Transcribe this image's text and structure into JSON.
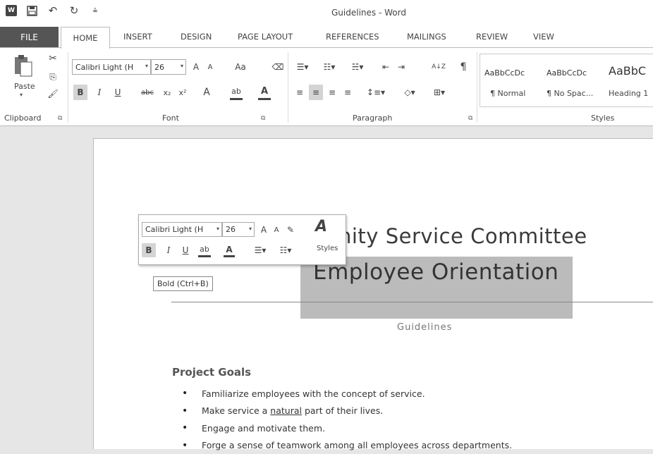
{
  "window": {
    "title": "Guidelines - Word",
    "qat": {
      "app_icon_label": "W",
      "save_icon": "save-icon",
      "undo_icon": "undo-icon",
      "redo_icon": "redo-icon",
      "customize_icon": "customize-qat-icon"
    }
  },
  "tabs": [
    "FILE",
    "HOME",
    "INSERT",
    "DESIGN",
    "PAGE LAYOUT",
    "REFERENCES",
    "MAILINGS",
    "REVIEW",
    "VIEW"
  ],
  "ribbon": {
    "clipboard": {
      "label": "Clipboard",
      "paste": "Paste"
    },
    "font": {
      "label": "Font",
      "font_name": "Calibri Light (H",
      "font_size": "26",
      "grow": "A",
      "shrink": "A",
      "case": "Aa",
      "bold": "B",
      "italic": "I",
      "underline": "U",
      "strike": "abc",
      "subscript": "x₂",
      "superscript": "x²",
      "effects": "A",
      "highlight": "ab",
      "color": "A"
    },
    "paragraph": {
      "label": "Paragraph",
      "sort": "A↓Z",
      "pilcrow": "¶"
    },
    "styles": {
      "label": "Styles",
      "items": [
        {
          "sample": "AaBbCcDc",
          "name": "¶ Normal"
        },
        {
          "sample": "AaBbCcDc",
          "name": "¶ No Spac..."
        },
        {
          "sample": "AaBbC",
          "name": "Heading 1"
        }
      ]
    }
  },
  "mini_toolbar": {
    "font_name": "Calibri Light (H",
    "font_size": "26",
    "grow": "A",
    "shrink": "A",
    "bold": "B",
    "italic": "I",
    "underline": "U",
    "highlight": "ab",
    "color": "A",
    "styles": "Styles"
  },
  "tooltip": "Bold (Ctrl+B)",
  "document": {
    "heading1": "nity Service Committee",
    "heading2": "Employee Orientation",
    "subtitle": "Guidelines",
    "section_heading": "Project Goals",
    "bullets": [
      {
        "pre": "Familiarize employees with the concept of service.",
        "u": "",
        "post": ""
      },
      {
        "pre": "Make service a ",
        "u": "natural",
        "post": " part of their lives."
      },
      {
        "pre": "Engage and motivate them.",
        "u": "",
        "post": ""
      },
      {
        "pre": "Forge a sense of teamwork among all employees across departments.",
        "u": "",
        "post": ""
      }
    ]
  }
}
